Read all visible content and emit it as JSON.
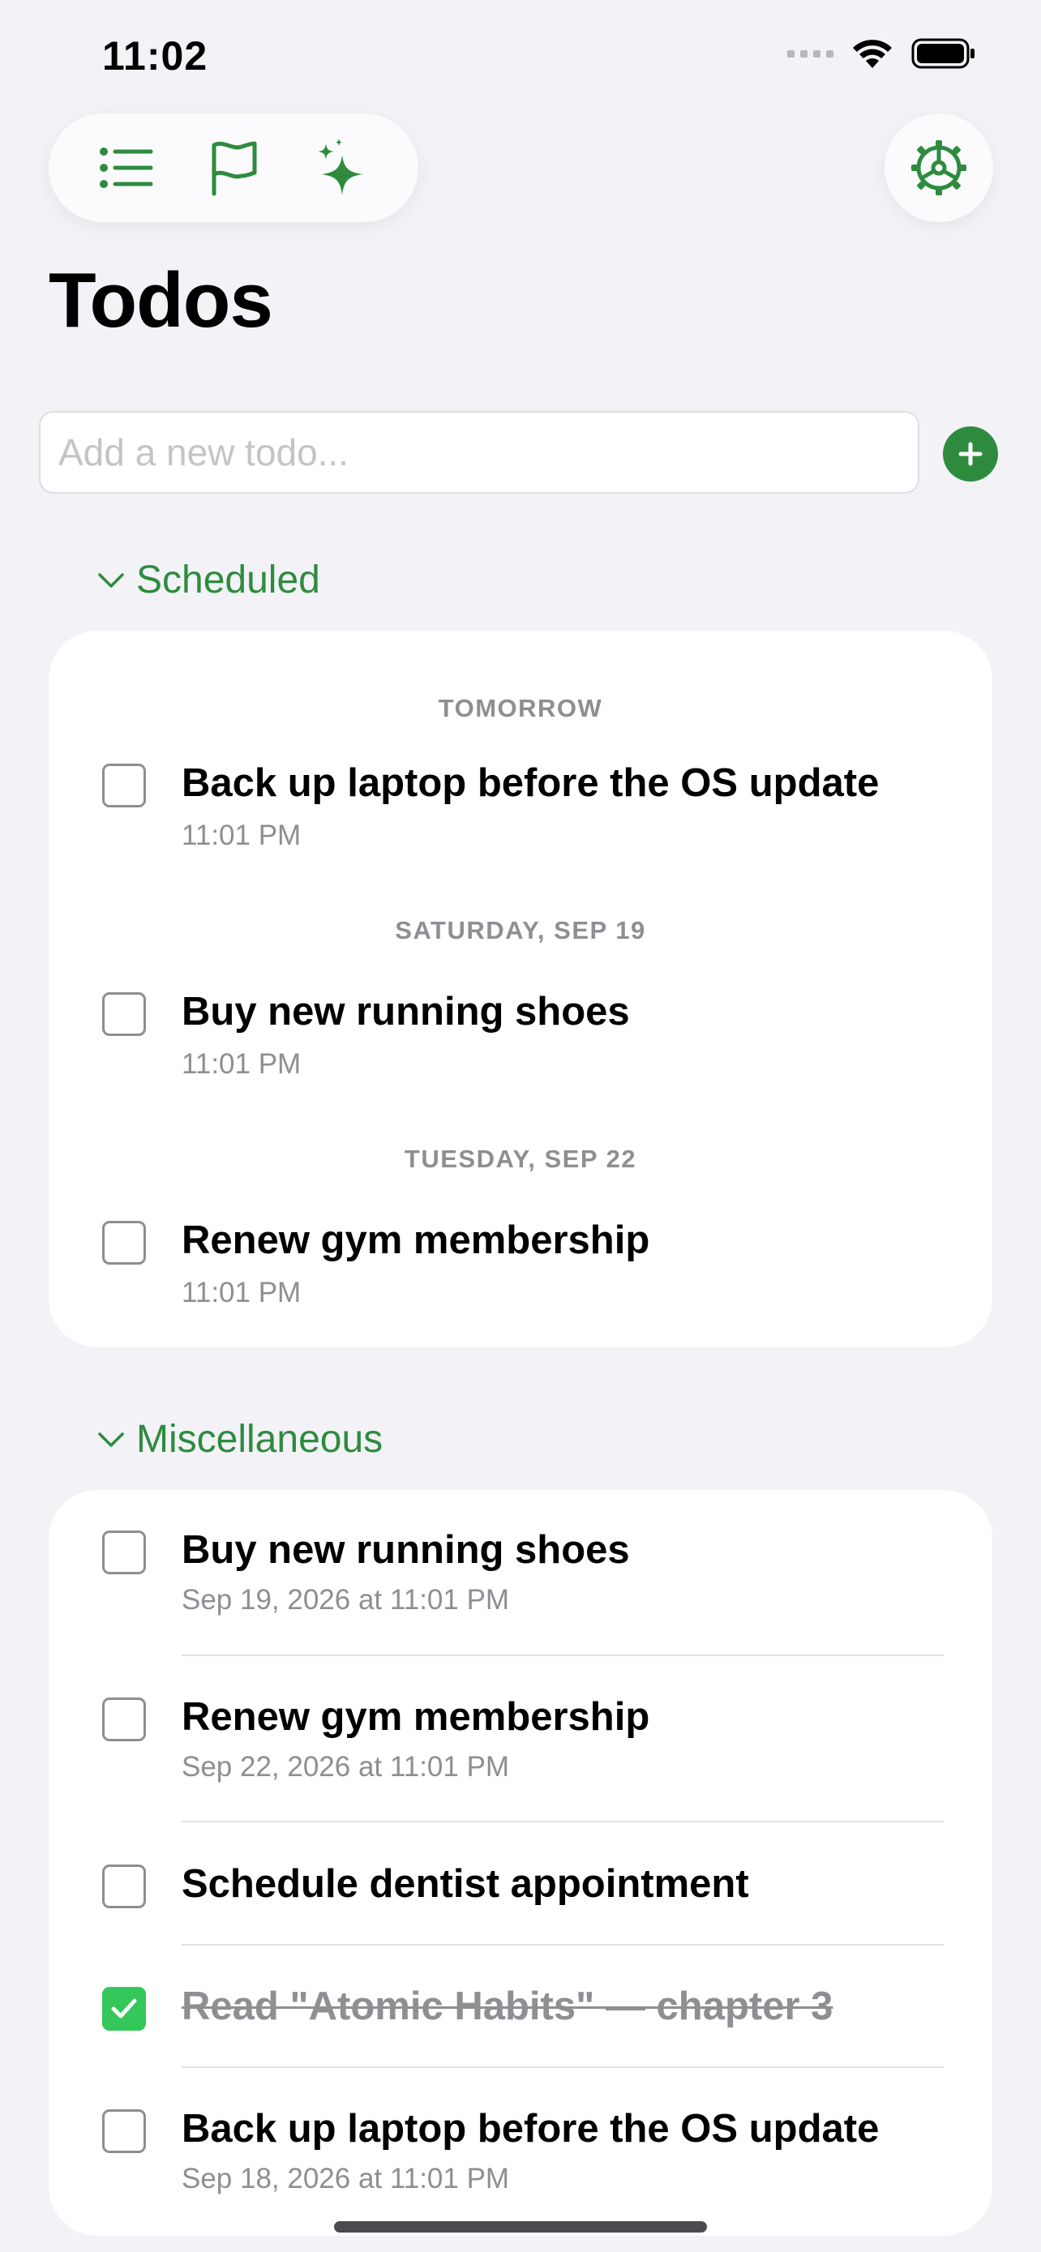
{
  "status": {
    "time": "11:02"
  },
  "page": {
    "title": "Todos"
  },
  "add": {
    "placeholder": "Add a new todo...",
    "value": ""
  },
  "colors": {
    "accent": "#2e8b3e",
    "checked": "#34c759",
    "secondary": "#8e8e93"
  },
  "toolbar": {
    "icons": [
      "list-icon",
      "flag-icon",
      "sparkles-icon"
    ],
    "settings_icon": "gear-icon"
  },
  "scheduled": {
    "header": "Scheduled",
    "groups": [
      {
        "date": "TOMORROW",
        "title": "Back up laptop before the OS update",
        "time": "11:01 PM",
        "done": false
      },
      {
        "date": "SATURDAY, SEP 19",
        "title": "Buy new running shoes",
        "time": "11:01 PM",
        "done": false
      },
      {
        "date": "TUESDAY, SEP 22",
        "title": "Renew gym membership",
        "time": "11:01 PM",
        "done": false
      }
    ]
  },
  "misc": {
    "header": "Miscellaneous",
    "items": [
      {
        "title": "Buy new running shoes",
        "subtitle": "Sep 19, 2026 at 11:01 PM",
        "done": false
      },
      {
        "title": "Renew gym membership",
        "subtitle": "Sep 22, 2026 at 11:01 PM",
        "done": false
      },
      {
        "title": "Schedule dentist appointment",
        "subtitle": "",
        "done": false
      },
      {
        "title": "Read \"Atomic Habits\" — chapter 3",
        "subtitle": "",
        "done": true
      },
      {
        "title": "Back up laptop before the OS update",
        "subtitle": "Sep 18, 2026 at 11:01 PM",
        "done": false
      }
    ]
  }
}
